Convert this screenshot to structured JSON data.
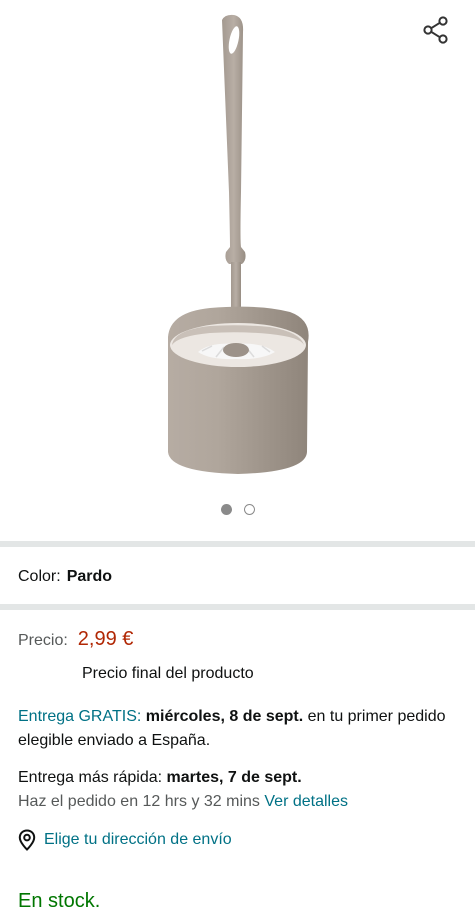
{
  "product": {
    "image_name": "toilet-brush-image",
    "carousel": {
      "count": 2,
      "active_index": 0
    }
  },
  "share": {
    "icon": "share-icon"
  },
  "color": {
    "label": "Color:",
    "value": "Pardo"
  },
  "price": {
    "label": "Precio:",
    "value": "2,99 €",
    "note": "Precio final del producto"
  },
  "delivery": {
    "prefix": "Entrega GRATIS:",
    "date": "miércoles, 8 de sept.",
    "suffix": "en tu primer pedido elegible enviado a España."
  },
  "fast_delivery": {
    "prefix": "Entrega más rápida:",
    "date": "martes, 7 de sept.",
    "order_within": "Haz el pedido en 12 hrs y 32 mins",
    "details_link": "Ver detalles"
  },
  "address": {
    "icon": "location-pin-icon",
    "label": "Elige tu dirección de envío"
  },
  "stock": {
    "label": "En stock."
  },
  "colors": {
    "price": "#b12704",
    "link": "#007185",
    "stock": "#007600",
    "product": "#a59b91"
  }
}
